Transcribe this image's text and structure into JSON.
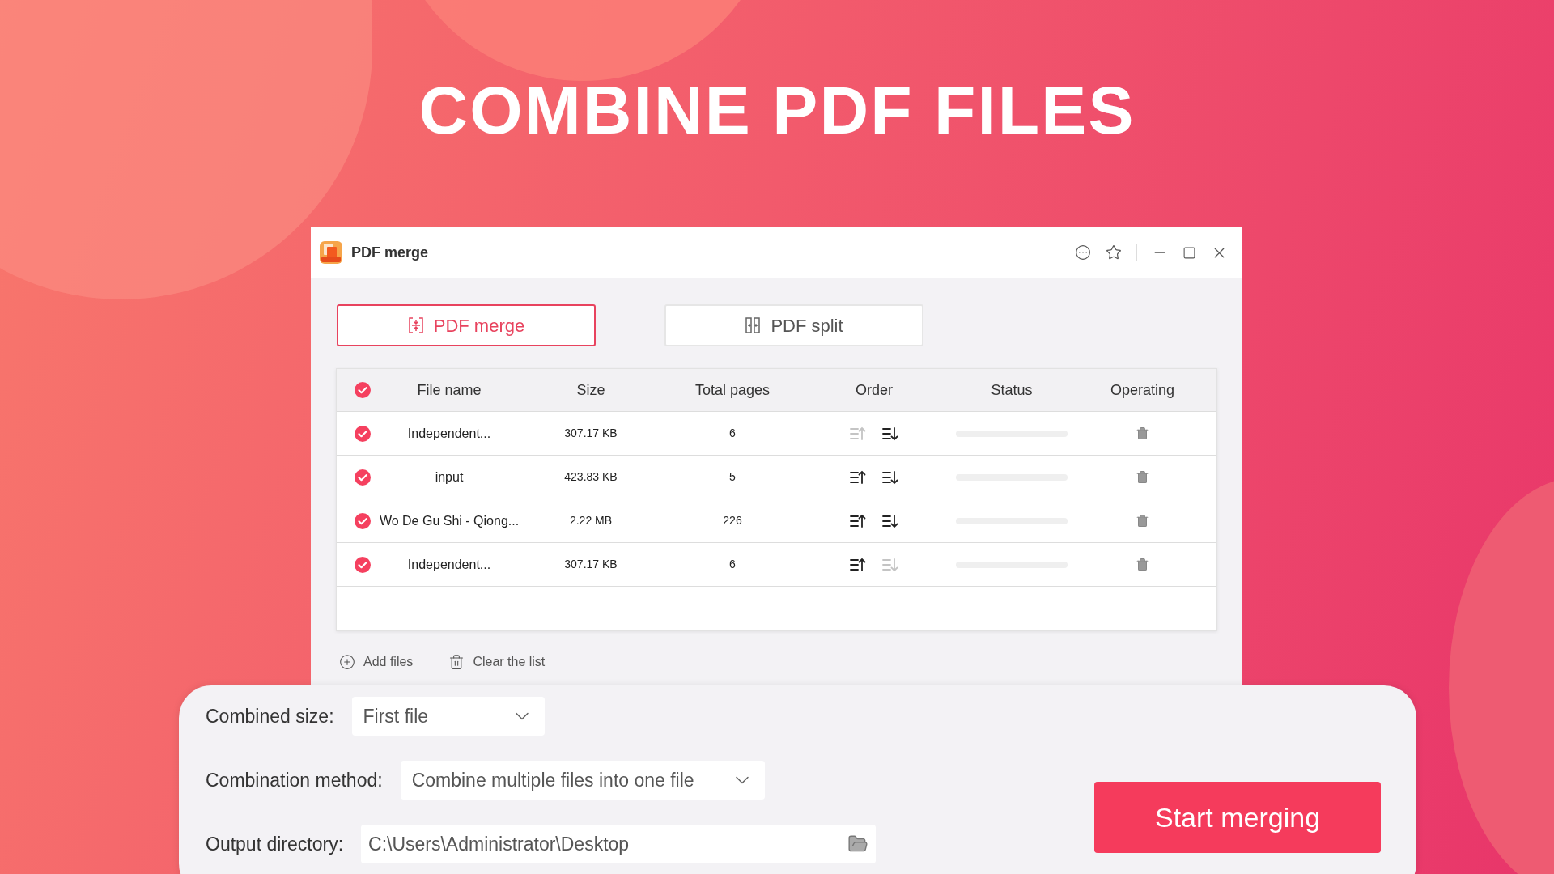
{
  "headline": "COMBINE PDF FILES",
  "window": {
    "title": "PDF merge"
  },
  "tabs": [
    {
      "label": "PDF merge",
      "kind": "merge",
      "selected": true
    },
    {
      "label": "PDF split",
      "kind": "split",
      "selected": false
    }
  ],
  "table": {
    "all_checked": true,
    "columns": [
      "File name",
      "Size",
      "Total pages",
      "Order",
      "Status",
      "Operating"
    ],
    "rows": [
      {
        "checked": true,
        "name": "Independent...",
        "size": "307.17 KB",
        "pages": "6",
        "up_disabled": true,
        "down_disabled": false,
        "level": 0
      },
      {
        "checked": true,
        "name": "input",
        "size": "423.83 KB",
        "pages": "5",
        "up_disabled": false,
        "down_disabled": false,
        "level": 0
      },
      {
        "checked": true,
        "name": "Wo De Gu Shi - Qiong...",
        "size": "2.22 MB",
        "pages": "226",
        "up_disabled": false,
        "down_disabled": false,
        "level": 0
      },
      {
        "checked": true,
        "name": "Independent...",
        "size": "307.17 KB",
        "pages": "6",
        "up_disabled": false,
        "down_disabled": true,
        "level": 0
      }
    ]
  },
  "actions": [
    "Add files",
    "Clear the list"
  ],
  "settings": {
    "combined_size": {
      "label": "Combined size:",
      "value": "First file"
    },
    "combination_method": {
      "label": "Combination method:",
      "value": "Combine multiple files into one file"
    },
    "output_directory": {
      "label": "Output directory:",
      "value": "C:\\Users\\Administrator\\Desktop"
    }
  },
  "start_button": "Start merging"
}
